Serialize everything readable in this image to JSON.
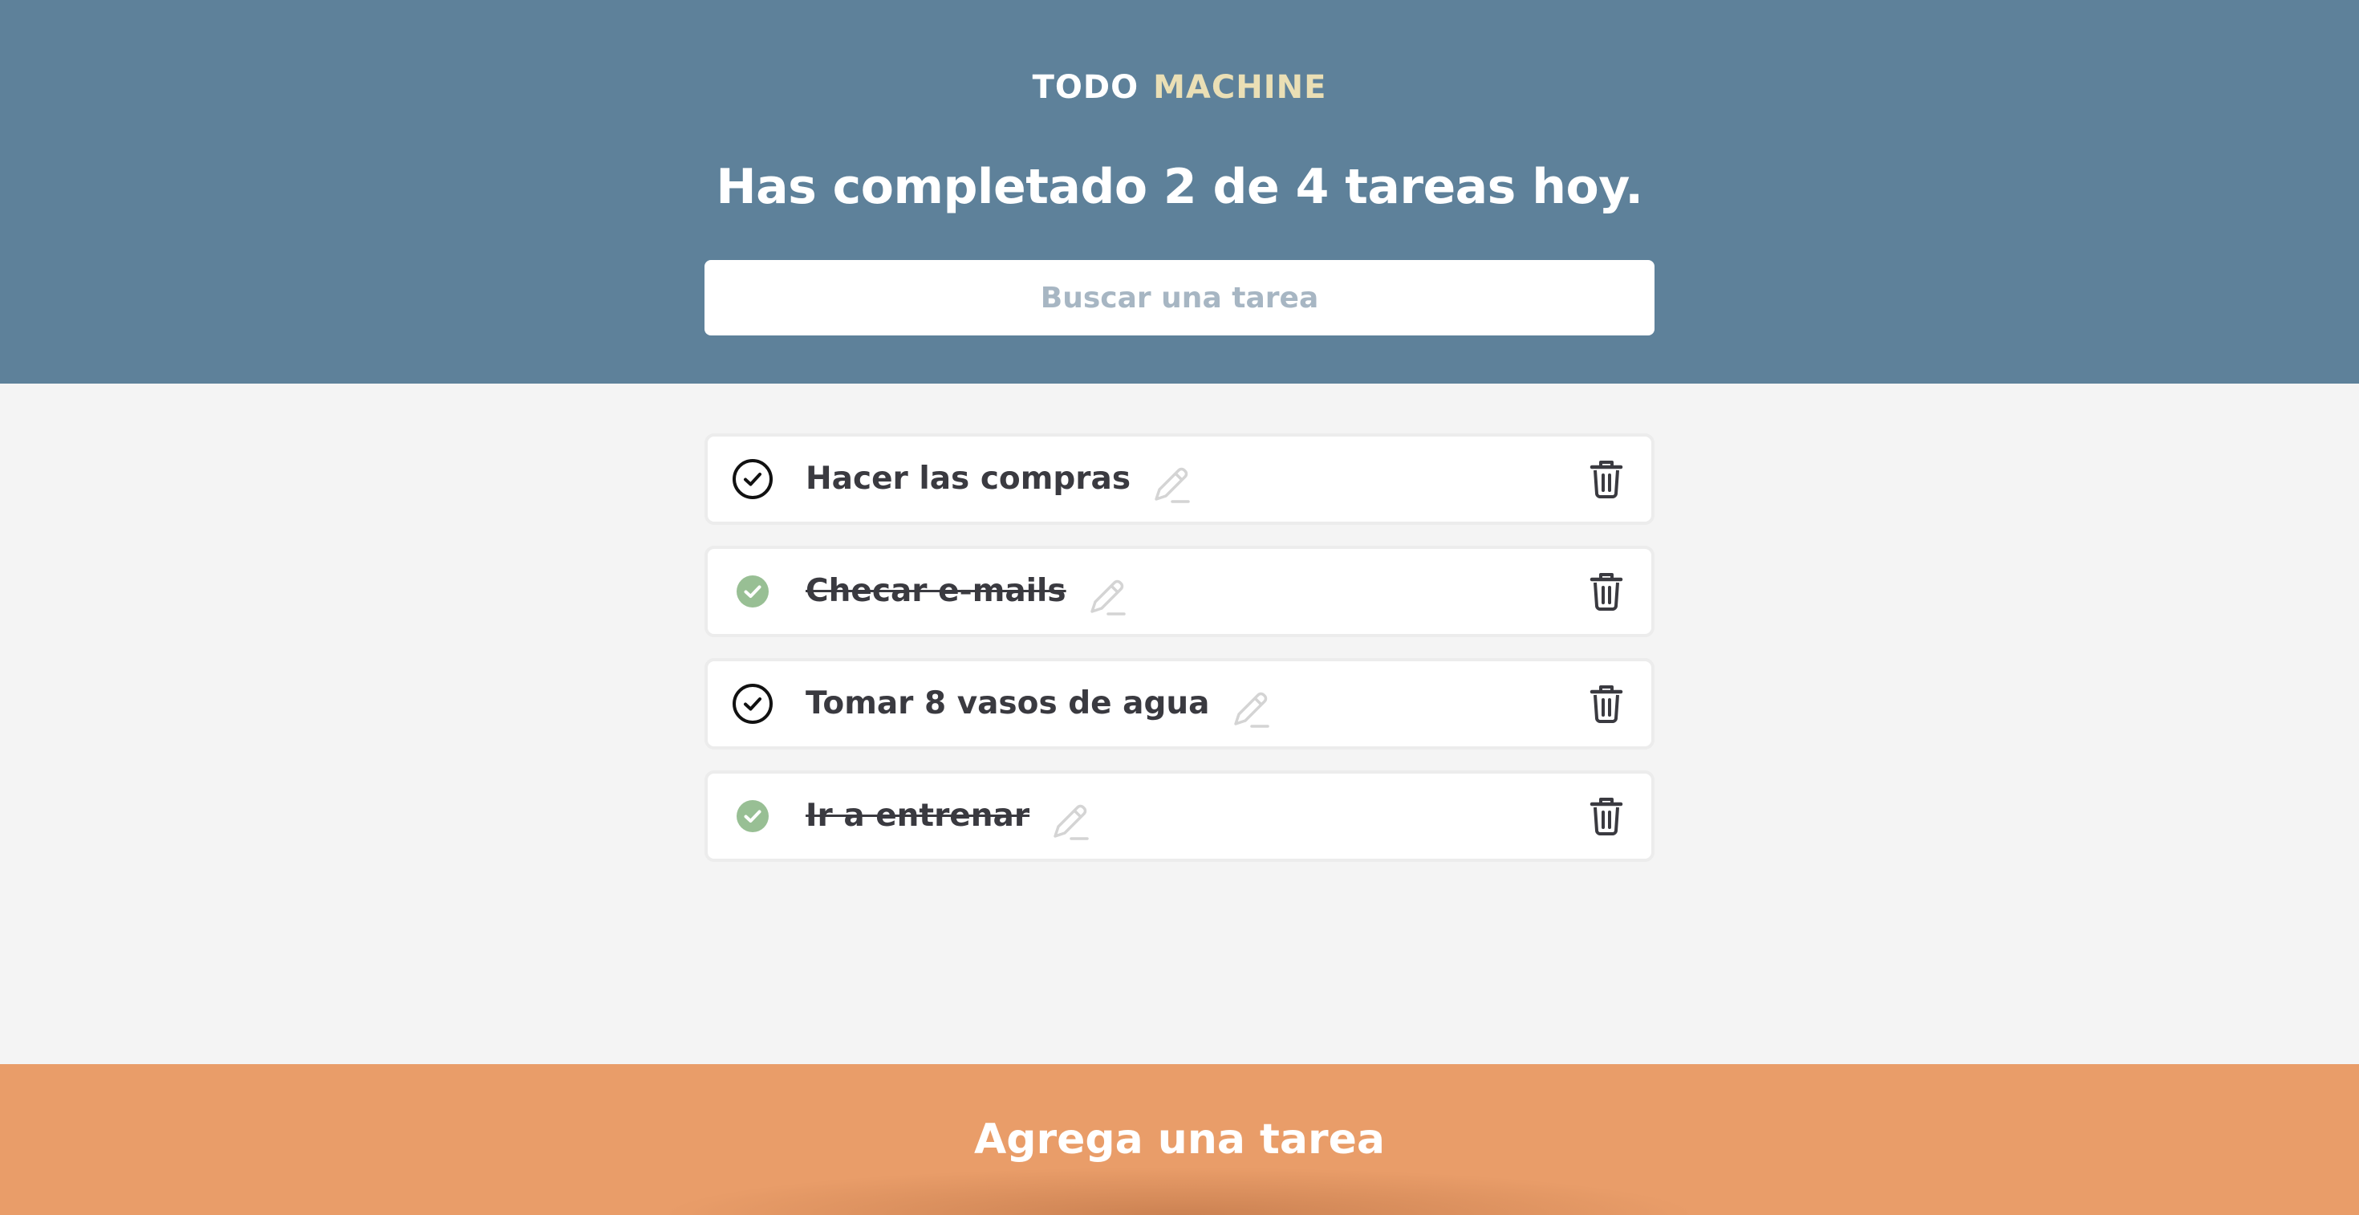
{
  "header": {
    "logo_part1": "TODO",
    "logo_part2": "MACHINE",
    "counter_text": "Has completado 2 de 4 tareas hoy."
  },
  "search": {
    "placeholder": "Buscar una tarea",
    "value": ""
  },
  "todos": [
    {
      "text": "Hacer las compras",
      "completed": false
    },
    {
      "text": "Checar e-mails",
      "completed": true
    },
    {
      "text": "Tomar 8 vasos de agua",
      "completed": false
    },
    {
      "text": "Ir a entrenar",
      "completed": true
    }
  ],
  "footer": {
    "add_label": "Agrega una tarea"
  },
  "colors": {
    "header_bg": "#5e819a",
    "accent_yellow": "#eadfb5",
    "complete_green": "#98bf94",
    "footer_orange": "#e99d69",
    "placeholder": "#a7b6c3"
  },
  "icons": {
    "check": "check-circle-icon",
    "edit": "pencil-icon",
    "delete": "trash-icon"
  }
}
